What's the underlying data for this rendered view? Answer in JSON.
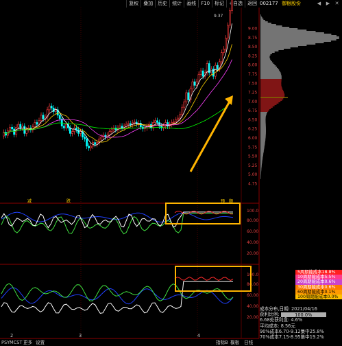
{
  "toolbar": {
    "items": [
      "复权",
      "叠加",
      "历史",
      "统计",
      "画线",
      "F10",
      "标记",
      "+自选",
      "返回"
    ],
    "sub": [
      "F10",
      "标记",
      "+自选"
    ]
  },
  "right_panel": {
    "code": "002177",
    "name": "御银股份",
    "price_ticks": [
      "9.00",
      "8.75",
      "8.50",
      "8.25",
      "8.00",
      "7.75",
      "7.50",
      "7.25",
      "7.00",
      "6.75",
      "6.50",
      "6.25",
      "6.00",
      "5.75",
      "5.50",
      "5.25",
      "5.00",
      "4.75"
    ],
    "peak_label": "9.37"
  },
  "pane_labels": {
    "ind1_top": "100.0",
    "ind1_ticks": [
      "80.00",
      "60.00",
      "40.00",
      "20.00"
    ],
    "ind2_top": "100.0",
    "ind2_ticks": [
      "80.00",
      "60.00",
      "40.00",
      "20.00"
    ],
    "signals": [
      "减",
      "跌",
      "预",
      "顺"
    ]
  },
  "legend": [
    {
      "label": "5周期能成本18.8%",
      "color": "#ff2020",
      "text": "#ffffff"
    },
    {
      "label": "10周期能成本5.5%",
      "color": "#ff3a8a",
      "text": "#ffffff"
    },
    {
      "label": "20周期能成本0.6%",
      "color": "#cc44cc",
      "text": "#ffffff"
    },
    {
      "label": "30周期能成本0.6%",
      "color": "#ff7a00",
      "text": "#ffffff"
    },
    {
      "label": "60周期能成本0.1%",
      "color": "#ff9a00",
      "text": "#000000"
    },
    {
      "label": "100周期能成本0.0%",
      "color": "#ffc000",
      "text": "#000000"
    }
  ],
  "info": {
    "line1": "成本分布,日期: 2021/04/16",
    "line2_label": "获利比例:",
    "line2_value": "100.0%",
    "line3": "6.68处获利盘: 4.6%",
    "line4": "平均成本: 8.56元",
    "line5": "90%成本6.70-9.12集中25.8%",
    "line6": "70%成本7.15-8.95集中19.2%"
  },
  "bottom": {
    "left": [
      "PSY",
      "MCST",
      "更多",
      "设置"
    ],
    "x_ticks": [
      "2",
      "3",
      "4"
    ],
    "right": [
      "指标B",
      "模板",
      "日线"
    ]
  },
  "colors": {
    "up": "#ff3b3b",
    "down": "#00ffff",
    "ma5": "#ffffff",
    "ma10": "#ffd200",
    "ma20": "#ff40ff",
    "ma60": "#00ff00",
    "highlight": "#ffb400",
    "grid": "#8b0000"
  }
}
